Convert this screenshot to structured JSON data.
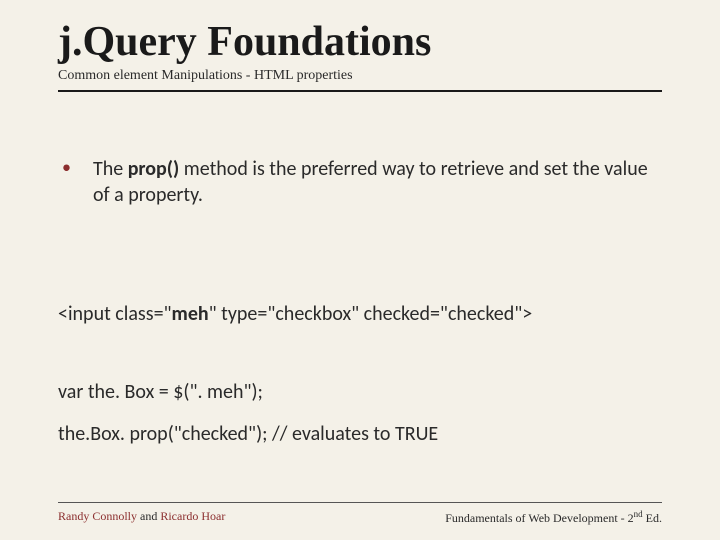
{
  "title": "j.Query Foundations",
  "subtitle": "Common element Manipulations - HTML properties",
  "bullet": {
    "marker": "•",
    "pre": " The ",
    "bold": "prop()",
    "post": "  method is the preferred way to retrieve and set the value of a property."
  },
  "code": {
    "input_pre": "<input class=\"",
    "input_bold": "meh",
    "input_post": "\" type=\"checkbox\" checked=\"checked\">",
    "var": "var the. Box = $(\". meh\");",
    "prop": "the.Box. prop(\"checked\"); // evaluates to TRUE"
  },
  "footer": {
    "left_a1": "Randy Connolly",
    "left_mid": " and ",
    "left_a2": "Ricardo Hoar",
    "right_pre": "Fundamentals of Web Development - 2",
    "right_sup": "nd",
    "right_post": " Ed."
  }
}
